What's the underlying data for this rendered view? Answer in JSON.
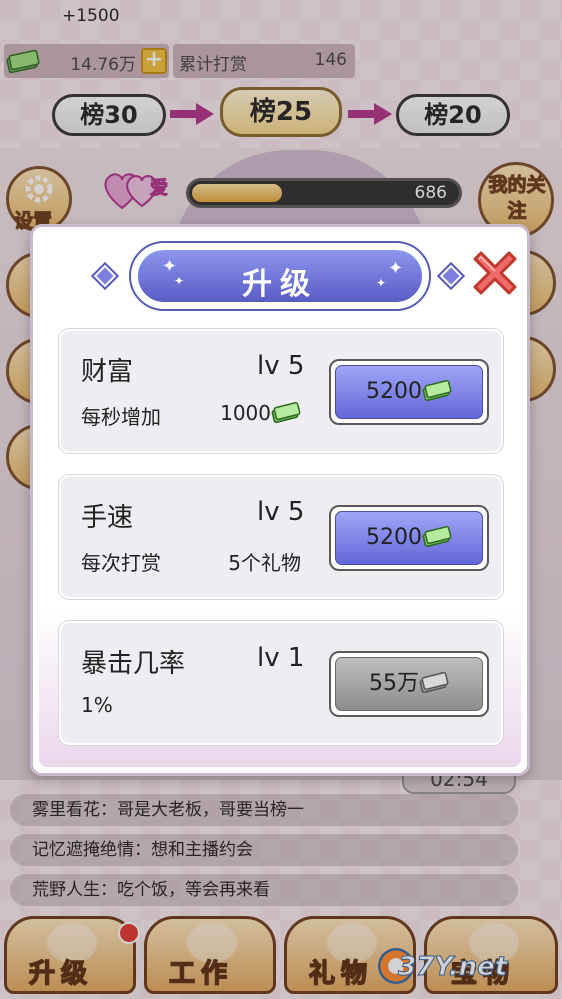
{
  "hud": {
    "gain": "+1500",
    "money": "14.76万",
    "tip_label": "累计打赏",
    "tip_count": "146"
  },
  "ranks": [
    "榜30",
    "榜25",
    "榜20"
  ],
  "side": {
    "settings": "设置",
    "follow": "我的关注",
    "love_label": "爱",
    "love_value": "686",
    "love_progress": 0.34
  },
  "chat": {
    "timer": "02:54",
    "messages": [
      "雾里看花：哥是大老板，哥要当榜一",
      "记忆遮掩绝情：想和主播约会",
      "荒野人生：吃个饭，等会再来看"
    ]
  },
  "bottom_nav": [
    "升级",
    "工作",
    "礼物",
    "宝物"
  ],
  "watermark": "37Y.net",
  "dialog": {
    "title": "升级",
    "upgrades": [
      {
        "name": "财富",
        "level": "lv 5",
        "desc": "每秒增加",
        "effect": "1000",
        "effect_icon": "cash-icon",
        "price": "5200",
        "enabled": true
      },
      {
        "name": "手速",
        "level": "lv 5",
        "desc": "每次打赏",
        "effect": "5个礼物",
        "effect_icon": "",
        "price": "5200",
        "enabled": true
      },
      {
        "name": "暴击几率",
        "level": "lv 1",
        "desc": "1%",
        "effect": "",
        "effect_icon": "",
        "price": "55万",
        "enabled": false
      }
    ]
  },
  "colors": {
    "accent_purple": "#6367d6",
    "close_red": "#e84a4a",
    "gold": "#e9b96a"
  }
}
